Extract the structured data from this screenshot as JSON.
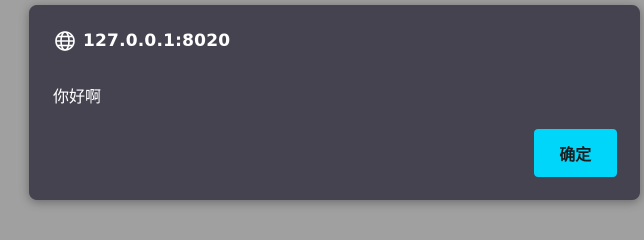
{
  "dialog": {
    "origin": "127.0.0.1:8020",
    "message": "你好啊",
    "ok_label": "确定",
    "icon": "globe-icon"
  },
  "colors": {
    "backdrop": "#a0a0a0",
    "dialog_bg": "#464350",
    "button_bg": "#00d5fa",
    "button_text": "#1b1b1b",
    "text": "#ffffff"
  }
}
